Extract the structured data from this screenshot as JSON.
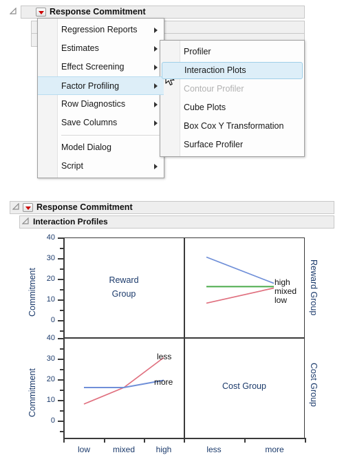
{
  "menu_section": {
    "outline_title": "Response Commitment",
    "disclosure_icon": "triangle-open-icon",
    "red_triangle_icon": "red-triangle-menu-icon",
    "primary_menu": {
      "items": [
        {
          "label": "Regression Reports",
          "submenu": true,
          "selected": false,
          "disabled": false
        },
        {
          "label": "Estimates",
          "submenu": true,
          "selected": false,
          "disabled": false
        },
        {
          "label": "Effect Screening",
          "submenu": true,
          "selected": false,
          "disabled": false
        },
        {
          "label": "Factor Profiling",
          "submenu": true,
          "selected": true,
          "disabled": false
        },
        {
          "label": "Row Diagnostics",
          "submenu": true,
          "selected": false,
          "disabled": false
        },
        {
          "label": "Save Columns",
          "submenu": true,
          "selected": false,
          "disabled": false
        },
        {
          "label": "Model Dialog",
          "submenu": false,
          "selected": false,
          "disabled": false
        },
        {
          "label": "Script",
          "submenu": true,
          "selected": false,
          "disabled": false
        }
      ]
    },
    "submenu": {
      "items": [
        {
          "label": "Profiler",
          "selected": false,
          "disabled": false
        },
        {
          "label": "Interaction Plots",
          "selected": true,
          "disabled": false
        },
        {
          "label": "Contour Profiler",
          "selected": false,
          "disabled": true
        },
        {
          "label": "Cube Plots",
          "selected": false,
          "disabled": false
        },
        {
          "label": "Box Cox Y Transformation",
          "selected": false,
          "disabled": false
        },
        {
          "label": "Surface Profiler",
          "selected": false,
          "disabled": false
        }
      ]
    },
    "cursor_icon": "mouse-pointer-icon"
  },
  "report_section": {
    "outline_title": "Response Commitment",
    "sub_outline_title": "Interaction Profiles",
    "disclosure_icon": "triangle-open-icon",
    "red_triangle_icon": "red-triangle-menu-icon"
  },
  "chart_data": {
    "type": "line",
    "title": "Interaction Profiles",
    "layout": "2x2 interaction profile matrix",
    "ylabel": "Commitment",
    "ylim": [
      -5,
      42
    ],
    "yticks": [
      0,
      10,
      20,
      30,
      40
    ],
    "yminor": [
      5,
      15,
      25,
      35
    ],
    "row_labels": [
      "Reward Group",
      "Cost Group"
    ],
    "col_tick_labels": [
      [
        "low",
        "mixed",
        "high"
      ],
      [
        "less",
        "more"
      ]
    ],
    "panels": [
      {
        "row": 0,
        "col": 0,
        "diagonal": true,
        "cell_text": [
          "Reward",
          "Group"
        ],
        "series": []
      },
      {
        "row": 0,
        "col": 1,
        "diagonal": false,
        "xlabels": [
          "less",
          "more"
        ],
        "series": [
          {
            "name": "high",
            "color": "#6f8fd8",
            "x": [
              "less",
              "more"
            ],
            "values": [
              30.5,
              17.8
            ]
          },
          {
            "name": "mixed",
            "color": "#4aaa4a",
            "x": [
              "less",
              "more"
            ],
            "values": [
              16.2,
              16.2
            ]
          },
          {
            "name": "low",
            "color": "#e0707f",
            "x": [
              "less",
              "more"
            ],
            "values": [
              8.2,
              15.5
            ]
          }
        ]
      },
      {
        "row": 1,
        "col": 0,
        "diagonal": false,
        "xlabels": [
          "low",
          "mixed",
          "high"
        ],
        "series": [
          {
            "name": "less",
            "color": "#e0707f",
            "x": [
              "low",
              "mixed",
              "high"
            ],
            "values": [
              8.0,
              16.0,
              30.5
            ]
          },
          {
            "name": "more",
            "color": "#6f8fd8",
            "x": [
              "low",
              "mixed",
              "high"
            ],
            "values": [
              16.0,
              16.0,
              19.5
            ]
          }
        ]
      },
      {
        "row": 1,
        "col": 1,
        "diagonal": true,
        "cell_text": [
          "Cost Group"
        ],
        "series": []
      }
    ],
    "colors": {
      "high": "#6f8fd8",
      "mixed": "#4aaa4a",
      "low": "#e0707f",
      "less": "#e0707f",
      "more": "#6f8fd8",
      "axis": "#3a3a3a",
      "label": "#1b3a6b"
    }
  }
}
